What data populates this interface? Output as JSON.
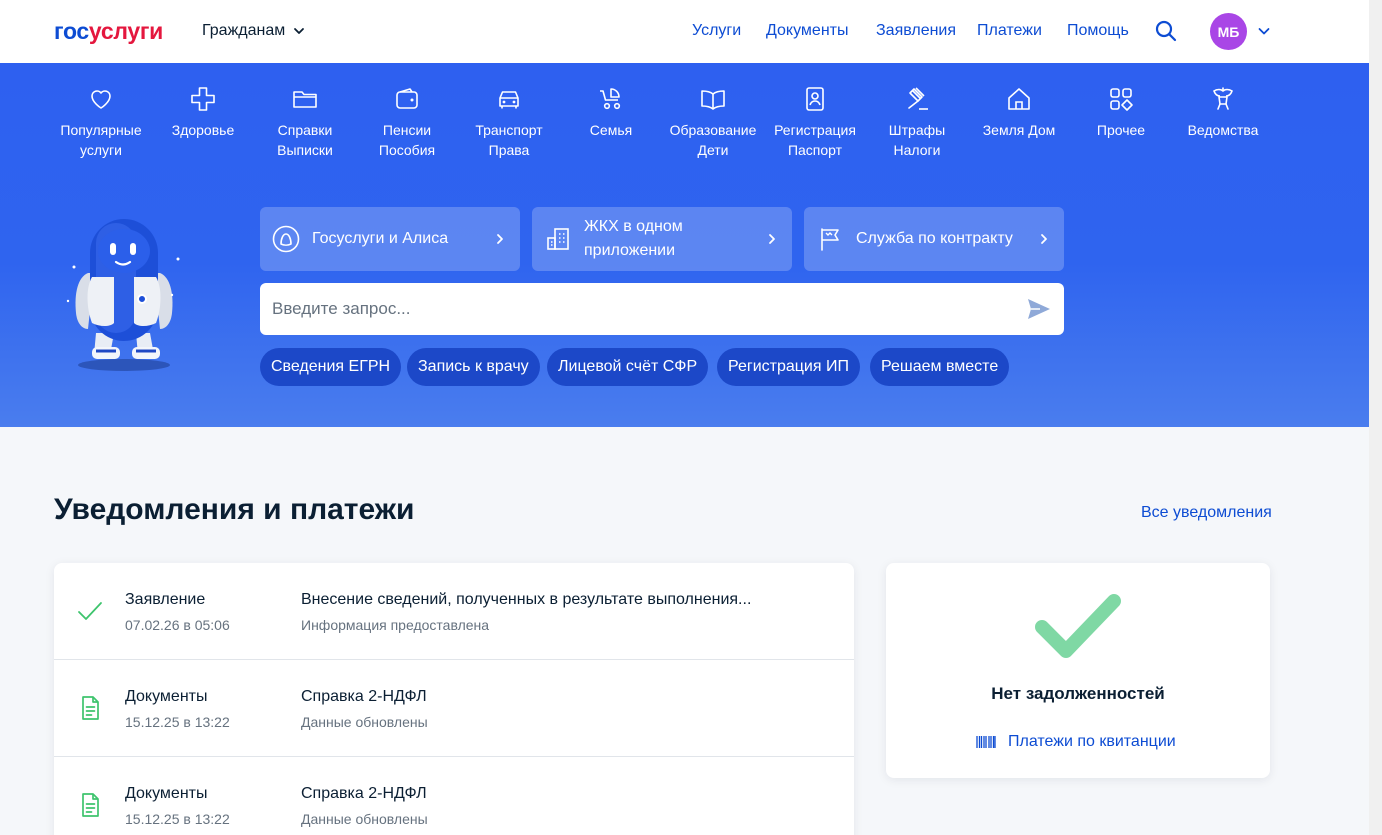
{
  "header": {
    "logo_part1": "гос",
    "logo_part2": "услуги",
    "audience": "Гражданам",
    "nav": [
      "Услуги",
      "Документы",
      "Заявления",
      "Платежи",
      "Помощь"
    ],
    "avatar_initials": "МБ",
    "search_icon": "search-icon"
  },
  "categories": [
    {
      "line1": "Популярные",
      "line2": "услуги",
      "icon": "heart-icon"
    },
    {
      "line1": "Здоровье",
      "line2": "",
      "icon": "health-cross-icon"
    },
    {
      "line1": "Справки",
      "line2": "Выписки",
      "icon": "folder-icon"
    },
    {
      "line1": "Пенсии",
      "line2": "Пособия",
      "icon": "wallet-icon"
    },
    {
      "line1": "Транспорт",
      "line2": "Права",
      "icon": "car-icon"
    },
    {
      "line1": "Семья",
      "line2": "",
      "icon": "stroller-icon"
    },
    {
      "line1": "Образование",
      "line2": "Дети",
      "icon": "book-icon"
    },
    {
      "line1": "Регистрация",
      "line2": "Паспорт",
      "icon": "passport-icon"
    },
    {
      "line1": "Штрафы",
      "line2": "Налоги",
      "icon": "gavel-icon"
    },
    {
      "line1": "Земля Дом",
      "line2": "",
      "icon": "house-icon"
    },
    {
      "line1": "Прочее",
      "line2": "",
      "icon": "grid-icon"
    },
    {
      "line1": "Ведомства",
      "line2": "",
      "icon": "emblem-icon"
    }
  ],
  "quick_links": [
    {
      "line1": "Госуслуги и Алиса",
      "line2": "",
      "icon": "alice-icon"
    },
    {
      "line1": "ЖКХ в одном",
      "line2": "приложении",
      "icon": "building-icon"
    },
    {
      "line1": "Служба по контракту",
      "line2": "",
      "icon": "flag-icon"
    }
  ],
  "search": {
    "placeholder": "Введите запрос..."
  },
  "chips": [
    "Сведения ЕГРН",
    "Запись к врачу",
    "Лицевой счёт СФР",
    "Регистрация ИП",
    "Решаем вместе"
  ],
  "notifications": {
    "title": "Уведомления и платежи",
    "all_link": "Все уведомления",
    "items": [
      {
        "type": "Заявление",
        "date": "07.02.26 в 05:06",
        "title": "Внесение сведений, полученных в результате выполнения...",
        "status": "Информация предоставлена",
        "icon": "check-icon"
      },
      {
        "type": "Документы",
        "date": "15.12.25 в 13:22",
        "title": "Справка 2-НДФЛ",
        "status": "Данные обновлены",
        "icon": "document-icon"
      },
      {
        "type": "Документы",
        "date": "15.12.25 в 13:22",
        "title": "Справка 2-НДФЛ",
        "status": "Данные обновлены",
        "icon": "document-icon"
      }
    ]
  },
  "debt": {
    "title": "Нет задолженностей",
    "link": "Платежи по квитанции"
  },
  "colors": {
    "brand_blue": "#0d4cd3",
    "brand_red": "#e4173e",
    "hero_blue": "#2e60f0",
    "chip_blue": "#1c48c8",
    "success_green": "#3ec46d",
    "avatar_purple": "#a946e6"
  }
}
